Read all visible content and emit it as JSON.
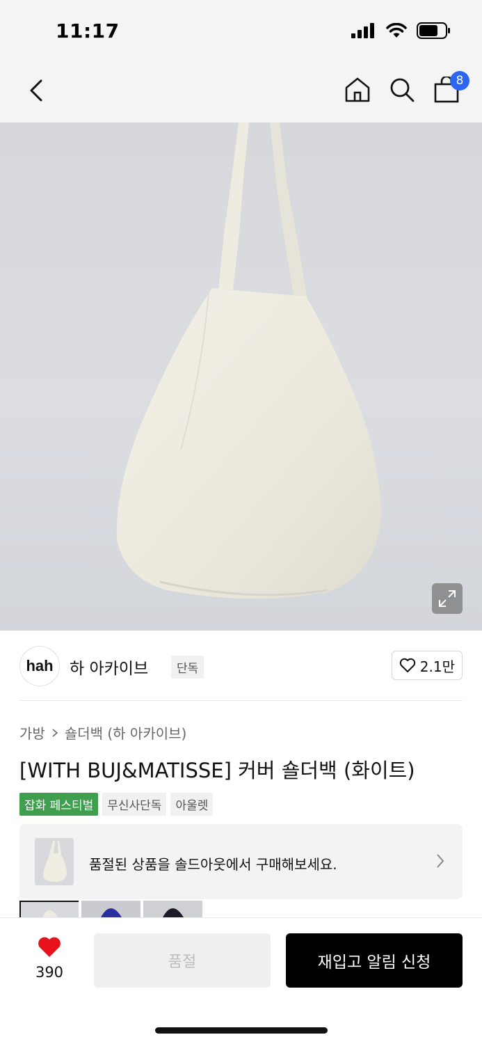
{
  "status_bar": {
    "time": "11:17"
  },
  "nav": {
    "cart_count": "8"
  },
  "brand": {
    "logo_text": "hah",
    "name": "하 아카이브",
    "tag": "단독",
    "like_count": "2.1만"
  },
  "breadcrumb": {
    "level1": "가방",
    "level2": "숄더백 (하 아카이브)"
  },
  "product": {
    "title": "[WITH BUJ&MATISSE] 커버 숄더백 (화이트)"
  },
  "tags": [
    "잡화 페스티벌",
    "무신사단독",
    "아울렛"
  ],
  "soldout_banner": {
    "text": "품절된 상품을 솔드아웃에서 구매해보세요."
  },
  "bottom_bar": {
    "wish_count": "390",
    "soldout_label": "품절",
    "restock_label": "재입고 알림 신청"
  },
  "colors": {
    "accent_blue": "#2c66f0",
    "tag_green": "#3f9f4e",
    "heart_red": "#e8121c"
  },
  "icons": [
    "signal-icon",
    "wifi-icon",
    "battery-icon",
    "back-chevron-icon",
    "home-icon",
    "search-icon",
    "shopping-bag-icon",
    "expand-icon",
    "heart-outline-icon",
    "chevron-right-icon",
    "heart-filled-icon"
  ]
}
